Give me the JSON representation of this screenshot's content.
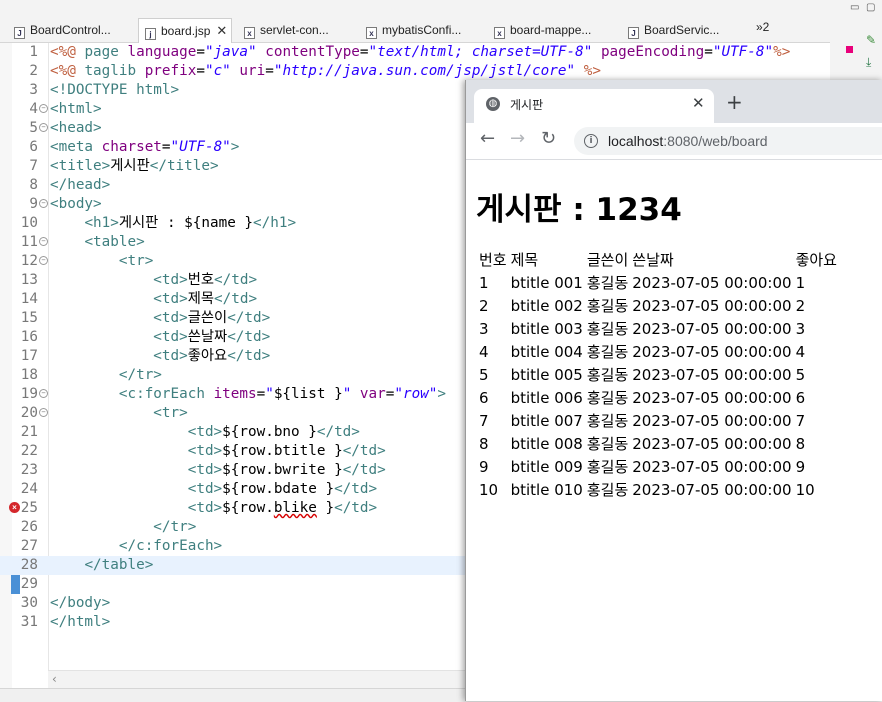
{
  "ide": {
    "tabs": [
      {
        "label": "BoardControl...",
        "icon": "J"
      },
      {
        "label": "board.jsp",
        "icon": "j"
      },
      {
        "label": "servlet-con...",
        "icon": "x"
      },
      {
        "label": "mybatisConfi...",
        "icon": "x"
      },
      {
        "label": "board-mappe...",
        "icon": "x"
      },
      {
        "label": "BoardServic...",
        "icon": "J"
      }
    ],
    "overflow_label": "»2",
    "code_lines": [
      {
        "n": "1",
        "fold": false,
        "html": "<span class='dr'>&lt;%@</span> <span class='tg'>page</span> <span class='at'>language</span>=<span class='av'>\"java\"</span> <span class='at'>contentType</span>=<span class='av'>\"text/html; charset=UTF-8\"</span> <span class='at'>pageEncoding</span>=<span class='av'>\"UTF-8\"</span><span class='dr'>%&gt;</span>"
      },
      {
        "n": "2",
        "fold": false,
        "html": "<span class='dr'>&lt;%@</span> <span class='tg'>taglib</span> <span class='at'>prefix</span>=<span class='av'>\"c\"</span> <span class='at'>uri</span>=<span class='av'>\"http://java.sun.com/jsp/jstl/core\"</span> <span class='dr'>%&gt;</span>"
      },
      {
        "n": "3",
        "fold": false,
        "html": "<span class='tg'>&lt;!DOCTYPE html&gt;</span>"
      },
      {
        "n": "4",
        "fold": true,
        "html": "<span class='tg'>&lt;html&gt;</span>"
      },
      {
        "n": "5",
        "fold": true,
        "html": "<span class='tg'>&lt;head&gt;</span>"
      },
      {
        "n": "6",
        "fold": false,
        "html": "<span class='tg'>&lt;meta</span> <span class='at'>charset</span>=<span class='av'>\"UTF-8\"</span><span class='tg'>&gt;</span>"
      },
      {
        "n": "7",
        "fold": false,
        "html": "<span class='tg'>&lt;title&gt;</span>게시판<span class='tg'>&lt;/title&gt;</span>"
      },
      {
        "n": "8",
        "fold": false,
        "html": "<span class='tg'>&lt;/head&gt;</span>"
      },
      {
        "n": "9",
        "fold": true,
        "html": "<span class='tg'>&lt;body&gt;</span>"
      },
      {
        "n": "10",
        "fold": false,
        "html": "    <span class='tg'>&lt;h1&gt;</span>게시판 : ${name }<span class='tg'>&lt;/h1&gt;</span>"
      },
      {
        "n": "11",
        "fold": true,
        "html": "    <span class='tg'>&lt;table&gt;</span>"
      },
      {
        "n": "12",
        "fold": true,
        "html": "        <span class='tg'>&lt;tr&gt;</span>"
      },
      {
        "n": "13",
        "fold": false,
        "html": "            <span class='tg'>&lt;td&gt;</span>번호<span class='tg'>&lt;/td&gt;</span>"
      },
      {
        "n": "14",
        "fold": false,
        "html": "            <span class='tg'>&lt;td&gt;</span>제목<span class='tg'>&lt;/td&gt;</span>"
      },
      {
        "n": "15",
        "fold": false,
        "html": "            <span class='tg'>&lt;td&gt;</span>글쓴이<span class='tg'>&lt;/td&gt;</span>"
      },
      {
        "n": "16",
        "fold": false,
        "html": "            <span class='tg'>&lt;td&gt;</span>쓴날짜<span class='tg'>&lt;/td&gt;</span>"
      },
      {
        "n": "17",
        "fold": false,
        "html": "            <span class='tg'>&lt;td&gt;</span>좋아요<span class='tg'>&lt;/td&gt;</span>"
      },
      {
        "n": "18",
        "fold": false,
        "html": "        <span class='tg'>&lt;/tr&gt;</span>"
      },
      {
        "n": "19",
        "fold": true,
        "html": "        <span class='tg'>&lt;c:forEach</span> <span class='at'>items</span>=<span class='av'>\"</span>${list }<span class='av'>\"</span> <span class='at'>var</span>=<span class='av'>\"row\"</span><span class='tg'>&gt;</span>"
      },
      {
        "n": "20",
        "fold": true,
        "html": "            <span class='tg'>&lt;tr&gt;</span>"
      },
      {
        "n": "21",
        "fold": false,
        "html": "                <span class='tg'>&lt;td&gt;</span>${row.bno }<span class='tg'>&lt;/td&gt;</span>"
      },
      {
        "n": "22",
        "fold": false,
        "html": "                <span class='tg'>&lt;td&gt;</span>${row.btitle }<span class='tg'>&lt;/td&gt;</span>"
      },
      {
        "n": "23",
        "fold": false,
        "html": "                <span class='tg'>&lt;td&gt;</span>${row.bwrite }<span class='tg'>&lt;/td&gt;</span>"
      },
      {
        "n": "24",
        "fold": false,
        "html": "                <span class='tg'>&lt;td&gt;</span>${row.bdate }<span class='tg'>&lt;/td&gt;</span>"
      },
      {
        "n": "25",
        "fold": false,
        "error": true,
        "html": "                <span class='tg'>&lt;td&gt;</span>${row.<span class='squig'>blike</span> }<span class='tg'>&lt;/td&gt;</span>"
      },
      {
        "n": "26",
        "fold": false,
        "html": "            <span class='tg'>&lt;/tr&gt;</span>"
      },
      {
        "n": "27",
        "fold": false,
        "html": "        <span class='tg'>&lt;/c:forEach&gt;</span>"
      },
      {
        "n": "28",
        "fold": false,
        "current": true,
        "html": "    <span class='tg'>&lt;/table&gt;</span>"
      },
      {
        "n": "29",
        "fold": false,
        "html": ""
      },
      {
        "n": "30",
        "fold": false,
        "html": "<span class='tg'>&lt;/body&gt;</span>"
      },
      {
        "n": "31",
        "fold": false,
        "html": "<span class='tg'>&lt;/html&gt;</span>"
      }
    ]
  },
  "browser": {
    "tab_title": "게시판",
    "url_host": "localhost",
    "url_path": ":8080/web/board",
    "page_heading": "게시판 : 1234",
    "table_header": [
      "번호",
      "제목",
      "글쓴이",
      "쓴날짜",
      "좋아요"
    ],
    "rows": [
      [
        "1",
        "btitle 001",
        "홍길동",
        "2023-07-05 00:00:00",
        "1"
      ],
      [
        "2",
        "btitle 002",
        "홍길동",
        "2023-07-05 00:00:00",
        "2"
      ],
      [
        "3",
        "btitle 003",
        "홍길동",
        "2023-07-05 00:00:00",
        "3"
      ],
      [
        "4",
        "btitle 004",
        "홍길동",
        "2023-07-05 00:00:00",
        "4"
      ],
      [
        "5",
        "btitle 005",
        "홍길동",
        "2023-07-05 00:00:00",
        "5"
      ],
      [
        "6",
        "btitle 006",
        "홍길동",
        "2023-07-05 00:00:00",
        "6"
      ],
      [
        "7",
        "btitle 007",
        "홍길동",
        "2023-07-05 00:00:00",
        "7"
      ],
      [
        "8",
        "btitle 008",
        "홍길동",
        "2023-07-05 00:00:00",
        "8"
      ],
      [
        "9",
        "btitle 009",
        "홍길동",
        "2023-07-05 00:00:00",
        "9"
      ],
      [
        "10",
        "btitle 010",
        "홍길동",
        "2023-07-05 00:00:00",
        "10"
      ]
    ]
  }
}
